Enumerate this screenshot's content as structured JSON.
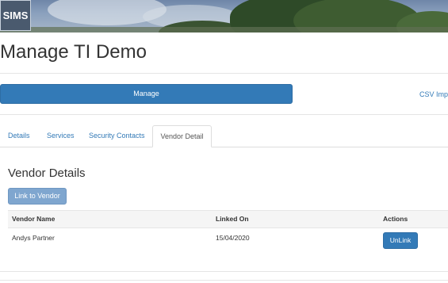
{
  "app": {
    "logo_text": "SIMS"
  },
  "page": {
    "title": "Manage TI Demo"
  },
  "actions": {
    "manage_label": "Manage",
    "csv_import_label": "CSV Impo"
  },
  "tabs": [
    {
      "label": "Details",
      "active": false
    },
    {
      "label": "Services",
      "active": false
    },
    {
      "label": "Security Contacts",
      "active": false
    },
    {
      "label": "Vendor Detail",
      "active": true
    }
  ],
  "vendor": {
    "section_title": "Vendor Details",
    "link_button_label": "Link to Vendor",
    "columns": [
      "Vendor Name",
      "Linked On",
      "Actions"
    ],
    "rows": [
      {
        "vendor_name": "Andys Partner",
        "linked_on": "15/04/2020",
        "action_label": "UnLink"
      }
    ]
  },
  "colors": {
    "primary": "#337ab7",
    "primary_light": "#7fa6cf",
    "link": "#337ab7"
  }
}
